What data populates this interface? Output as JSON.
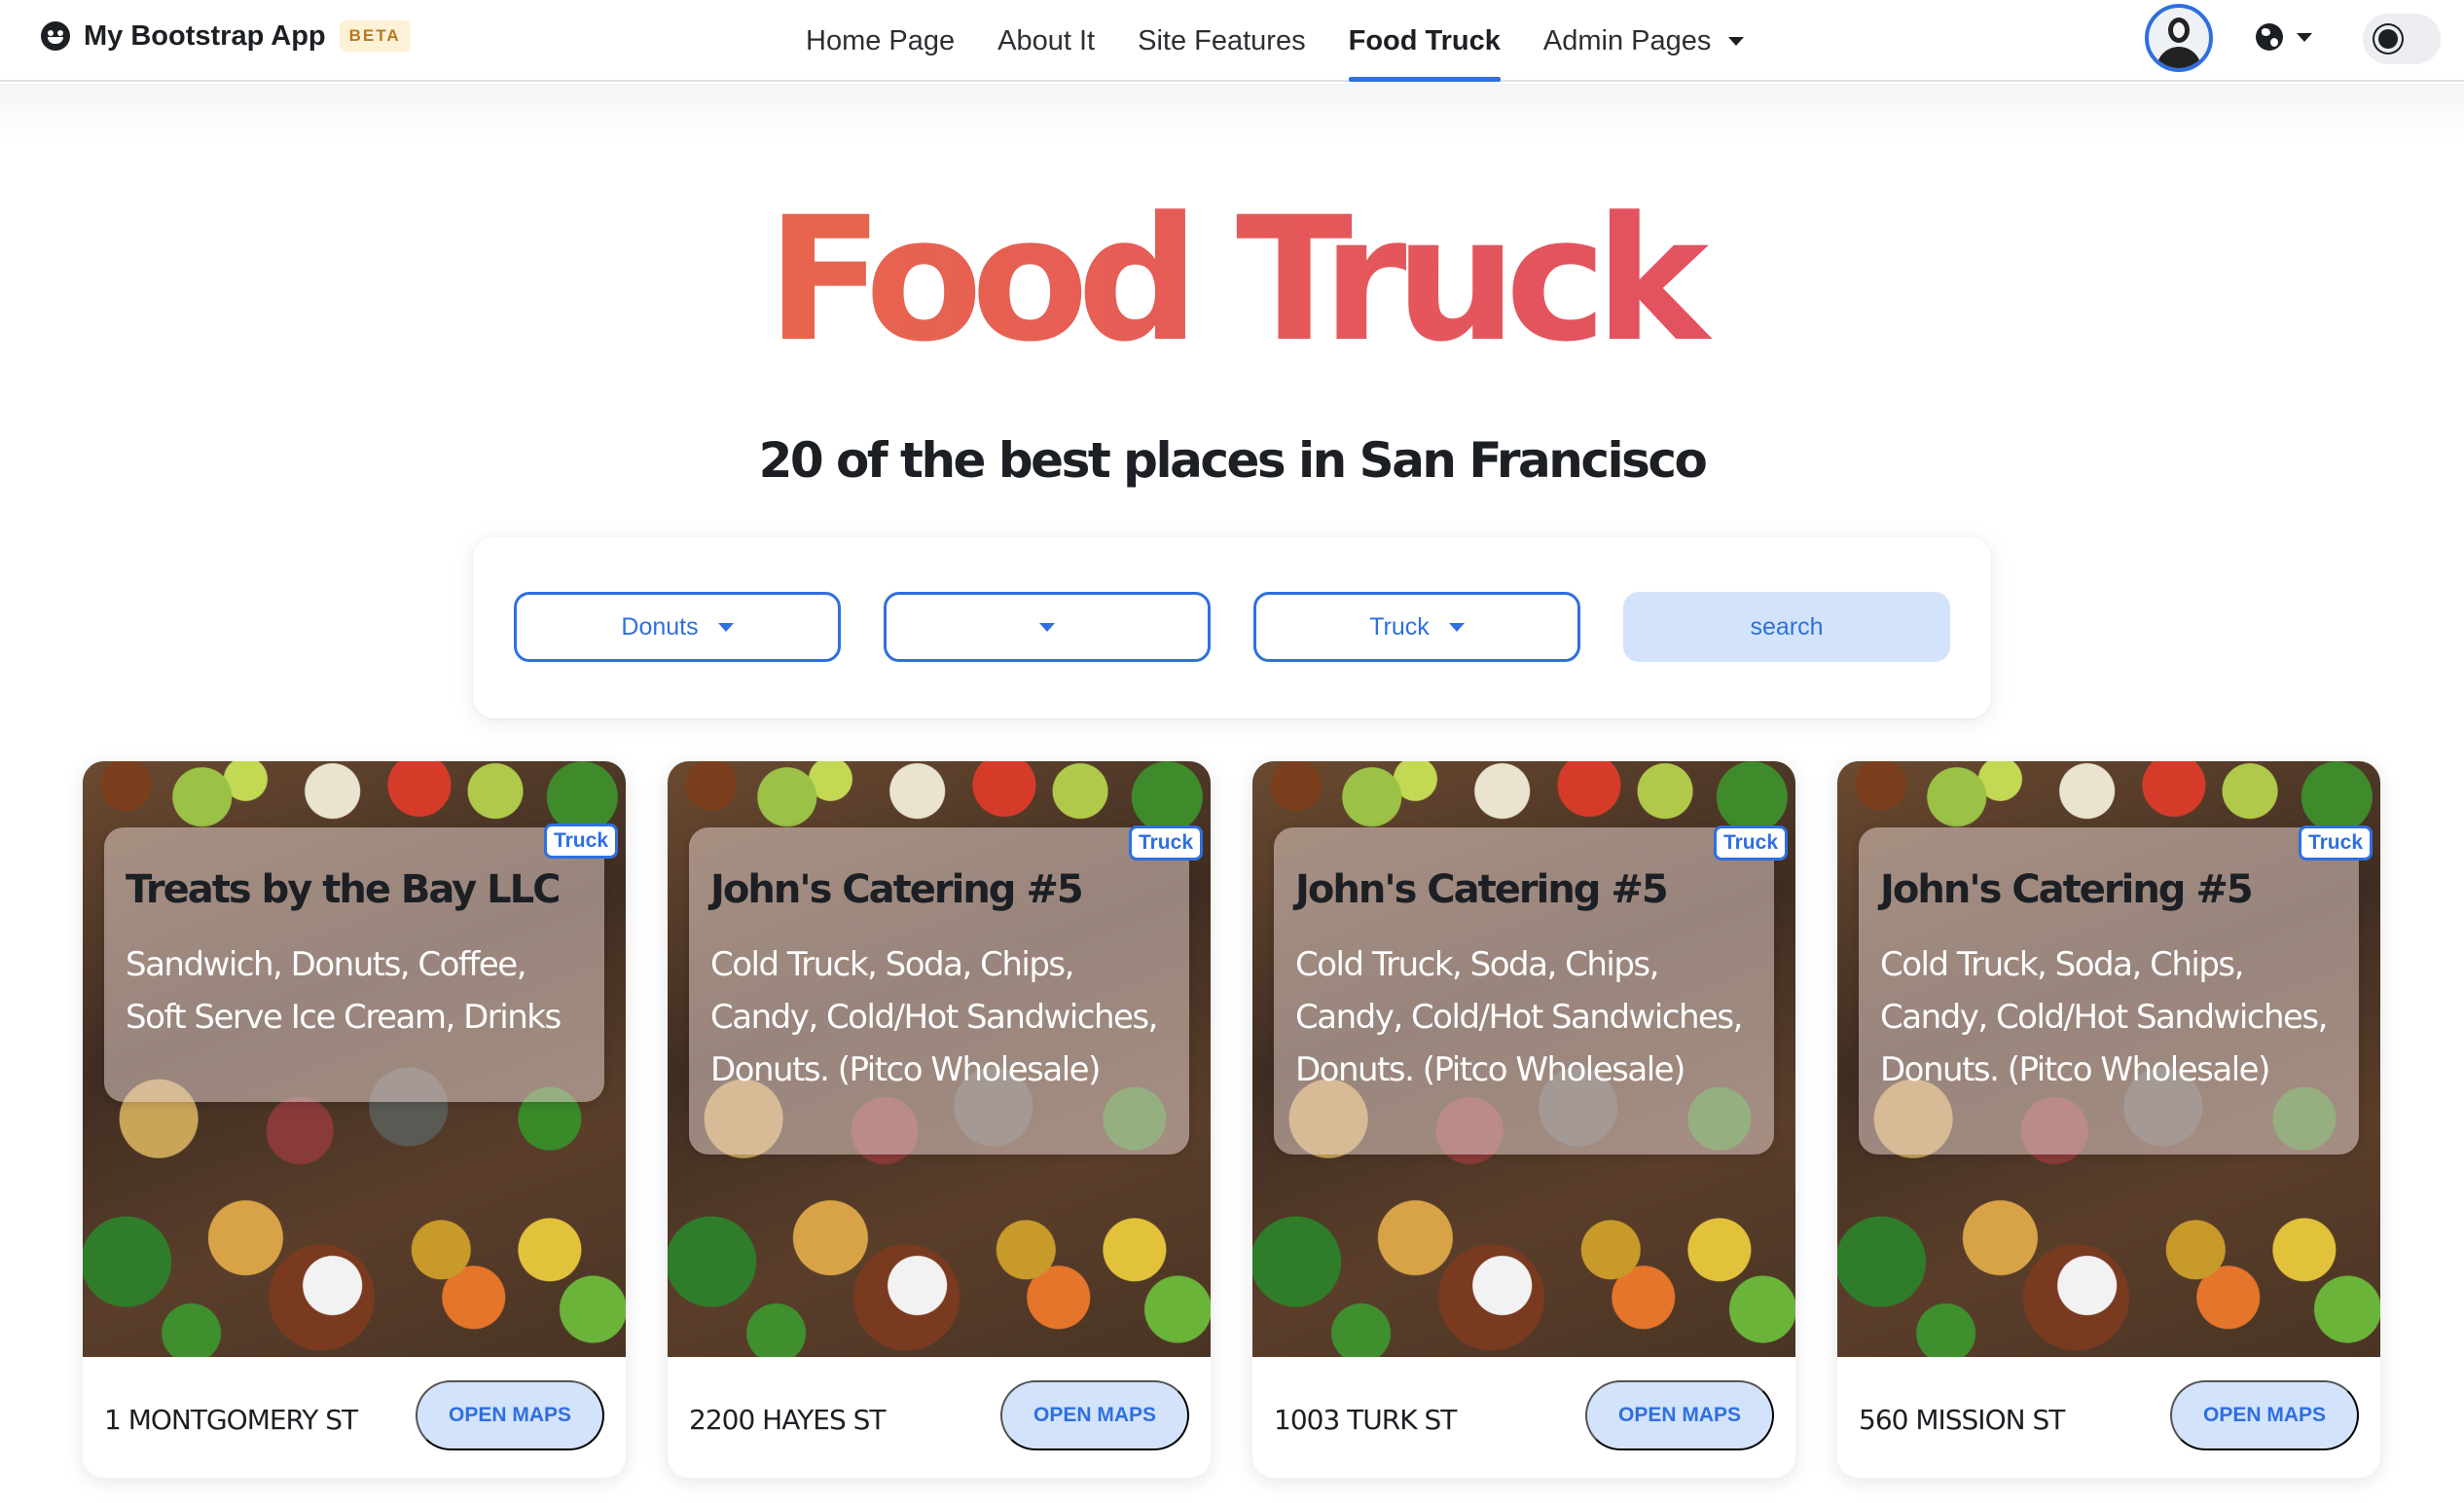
{
  "navbar": {
    "brand": "My Bootstrap App",
    "badge": "BETA",
    "links": [
      {
        "label": "Home Page"
      },
      {
        "label": "About It"
      },
      {
        "label": "Site Features"
      },
      {
        "label": "Food Truck",
        "active": true
      },
      {
        "label": "Admin Pages"
      }
    ],
    "icons": [
      "smiley-icon",
      "avatar",
      "globe-icon",
      "sun-icon"
    ]
  },
  "hero": {
    "title": "Food Truck",
    "subtitle": "20 of the best places in San Francisco"
  },
  "filters": {
    "filter1_value": "Donuts",
    "filter2_value": "",
    "filter3_value": "Truck",
    "search_label": "search"
  },
  "cards": [
    {
      "badge": "Truck",
      "title": "Treats by the Bay LLC",
      "description": "Sandwich, Donuts, Coffee, Soft Serve Ice Cream, Drinks",
      "address": "1 MONTGOMERY ST",
      "button": "OPEN MAPS"
    },
    {
      "badge": "Truck",
      "title": "John's Catering #5",
      "description": "Cold Truck, Soda, Chips, Candy, Cold/Hot Sandwiches, Donuts. (Pitco Wholesale)",
      "address": "2200 HAYES ST",
      "button": "OPEN MAPS"
    },
    {
      "badge": "Truck",
      "title": "John's Catering #5",
      "description": "Cold Truck, Soda, Chips, Candy, Cold/Hot Sandwiches, Donuts. (Pitco Wholesale)",
      "address": "1003 TURK ST",
      "button": "OPEN MAPS"
    },
    {
      "badge": "Truck",
      "title": "John's Catering #5",
      "description": "Cold Truck, Soda, Chips, Candy, Cold/Hot Sandwiches, Donuts. (Pitco Wholesale)",
      "address": "560 MISSION ST",
      "button": "OPEN MAPS"
    }
  ],
  "colors": {
    "accent": "#2f6fe0",
    "title_gradient_start": "#ec7a3a",
    "title_gradient_end": "#e0456a",
    "button_bg": "#d3e3fb"
  }
}
